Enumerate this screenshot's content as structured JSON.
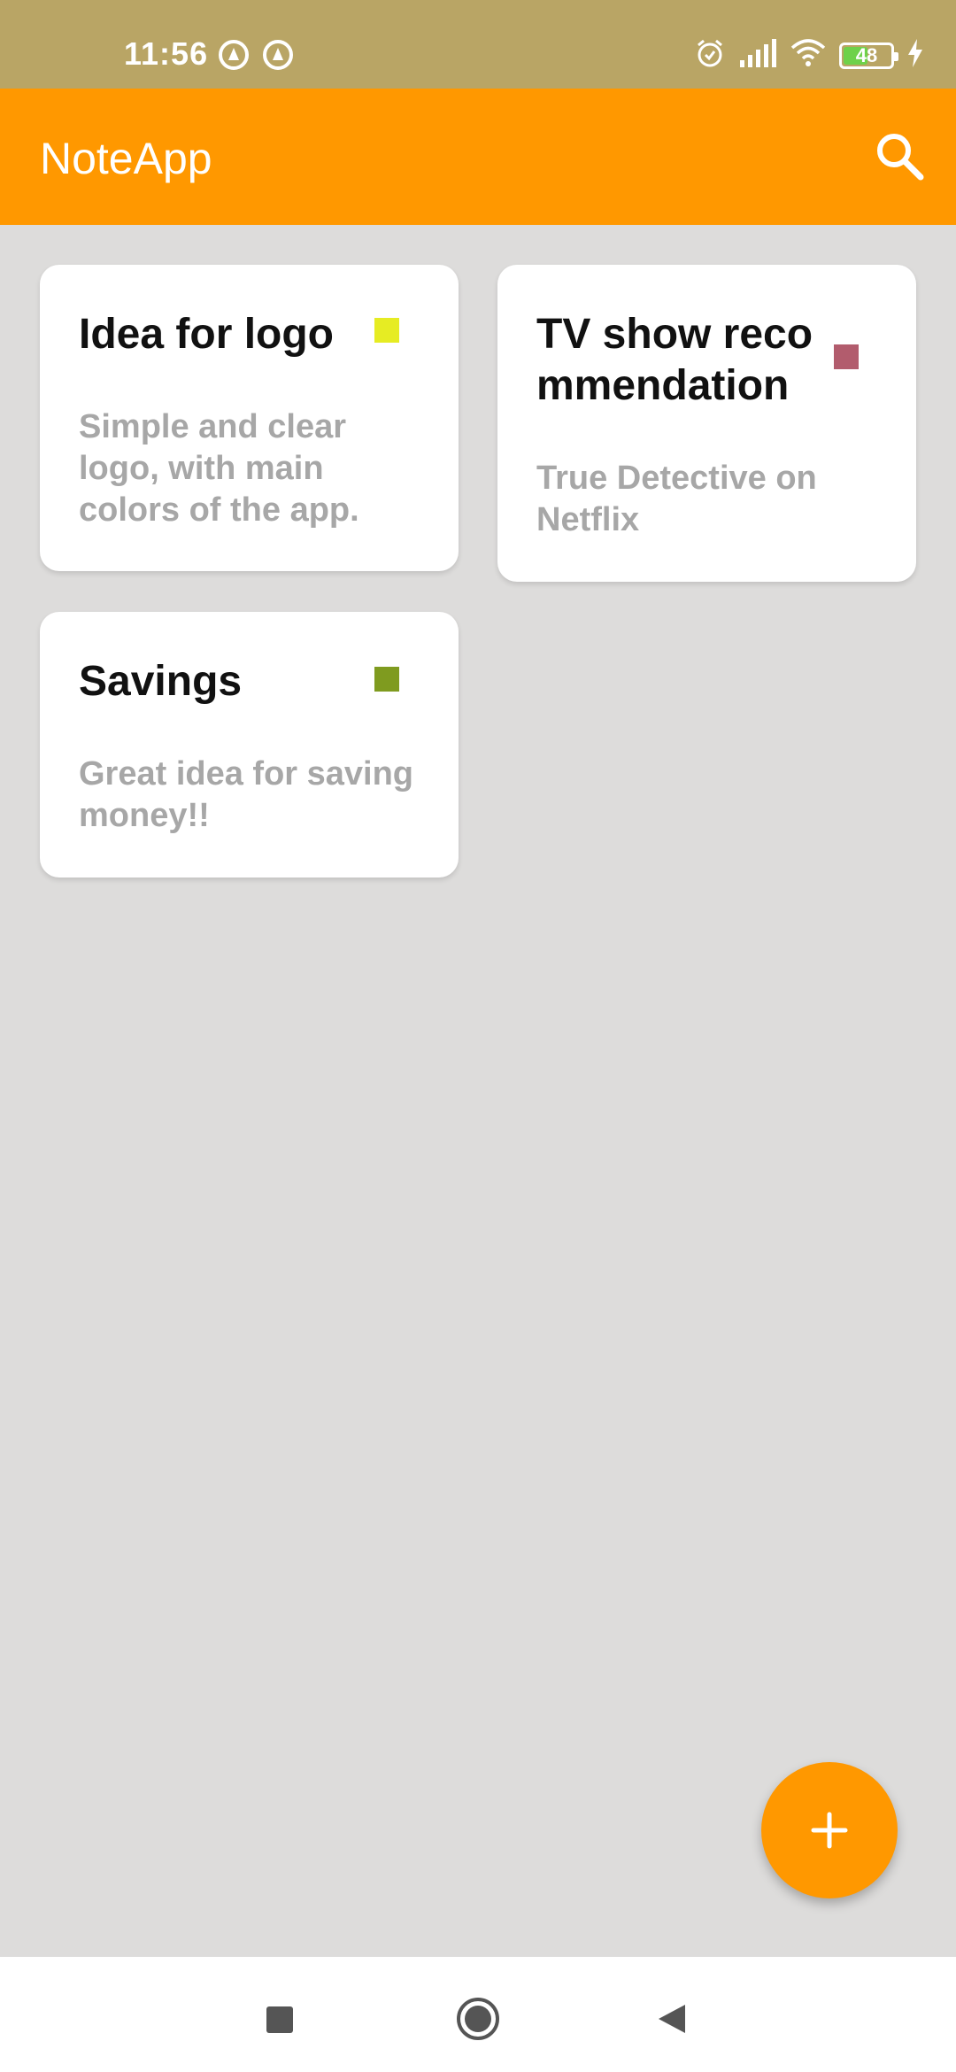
{
  "status_bar": {
    "time": "11:56",
    "battery_level": "48",
    "icons": [
      "notification-icon",
      "notification-icon",
      "alarm-icon",
      "signal-icon",
      "wifi-icon",
      "battery-icon",
      "charging-icon"
    ]
  },
  "app_bar": {
    "title": "NoteApp",
    "search_icon": "search-icon"
  },
  "notes": [
    {
      "title": "Idea for logo",
      "body": "Simple and clear logo, with main colors of the app.",
      "color": "#e6ec23"
    },
    {
      "title": "TV show recommendation",
      "body": "True Detective on Netflix",
      "color": "#b25c6d"
    },
    {
      "title": "Savings",
      "body": "Great idea for saving money!!",
      "color": "#7f9b1f"
    }
  ],
  "fab": {
    "icon": "plus-icon",
    "color": "#ff9800"
  },
  "nav_bar": {
    "buttons": [
      "recents-icon",
      "home-icon",
      "back-icon"
    ]
  },
  "colors": {
    "app_bar": "#ff9800",
    "status_bar": "#b9a565",
    "background": "#dddcdb"
  }
}
